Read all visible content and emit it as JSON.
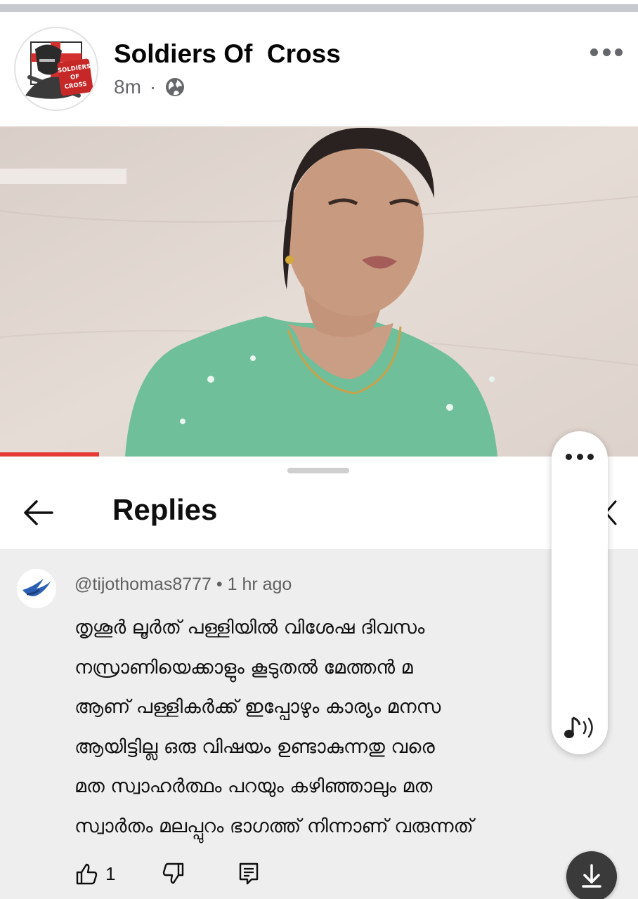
{
  "post": {
    "page_name": "Soldiers Of  Cross",
    "time_ago": "8m",
    "separator": "·",
    "audience_icon": "globe-icon",
    "more_icon": "more-horizontal-icon",
    "avatar_logo_text": [
      "SOLDIERS",
      "OF",
      "CROSS"
    ]
  },
  "video": {
    "progress_fraction": 0.155
  },
  "replies_panel": {
    "title": "Replies",
    "back_icon": "arrow-left-icon",
    "comment": {
      "author_handle": "@tijothomas8777",
      "separator": " • ",
      "time_ago": "1 hr ago",
      "lines": [
        "തൃശൂർ ലൂർത് പള്ളിയിൽ വിശേഷ ദിവസം",
        "നസ്രാണിയെക്കാളും കൂടുതൽ മേത്തൻ മ",
        "ആണ് പള്ളികർക്ക് ഇപ്പോഴും കാര്യം മനസ",
        "ആയിട്ടില്ല ഒരു വിഷയം ഉണ്ടാകുന്നതു വരെ",
        "മത സ്വാഹർത്ഥം പറയും കഴിഞ്ഞാലും മത",
        "സ്വാർതം മലപ്പുറം ഭാഗത്ത് നിന്നാണ് വരുന്നത്"
      ],
      "like_count": "1",
      "like_icon": "thumbs-up-icon",
      "dislike_icon": "thumbs-down-icon",
      "reply_icon": "comment-icon"
    }
  },
  "floating_panel": {
    "more_icon": "more-horizontal-icon",
    "audio_icon": "audio-note-icon"
  },
  "download_button": {
    "icon": "download-icon"
  },
  "colors": {
    "progress": "#e53935",
    "comment_bg": "#eeeeee",
    "secondary_text": "#606060",
    "fab_bg": "#3a3a3a"
  }
}
